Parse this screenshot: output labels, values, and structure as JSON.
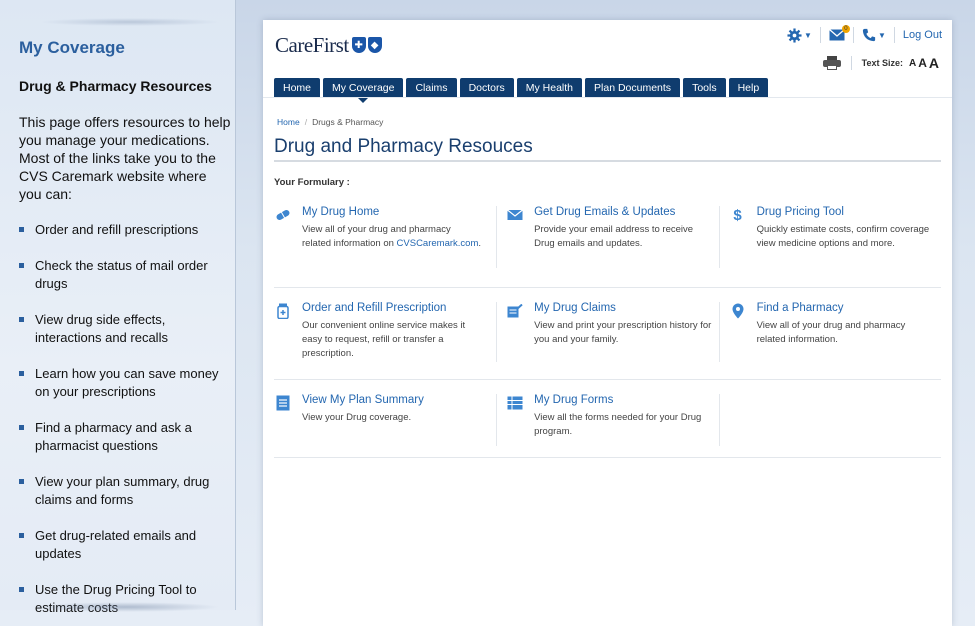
{
  "sidebar": {
    "title": "My Coverage",
    "subtitle": "Drug & Pharmacy Resources",
    "intro": "This page offers resources to help you manage your medications. Most of the links take you to the CVS Caremark website where you can:",
    "items": [
      "Order and refill prescriptions",
      "Check the status of mail order drugs",
      "View drug side effects, interactions and recalls",
      "Learn how you can save money on your prescriptions",
      "Find a pharmacy and ask a pharmacist questions",
      "View your plan summary, drug claims and forms",
      "Get drug-related emails and updates",
      "Use the Drug Pricing Tool to estimate costs"
    ]
  },
  "header": {
    "logo_text": "CareFirst",
    "logout_label": "Log Out",
    "message_badge": "0",
    "text_size_label": "Text Size:",
    "text_size_options": [
      "A",
      "A",
      "A"
    ]
  },
  "nav": {
    "tabs": [
      "Home",
      "My Coverage",
      "Claims",
      "Doctors",
      "My Health",
      "Plan Documents",
      "Tools",
      "Help"
    ],
    "active": "My Coverage"
  },
  "breadcrumb": {
    "home": "Home",
    "separator": "/",
    "current": "Drugs & Pharmacy"
  },
  "page": {
    "title": "Drug and Pharmacy Resouces",
    "formulary_label": "Your Formulary :"
  },
  "resources": [
    {
      "icon": "pill-icon",
      "title": "My Drug Home",
      "desc": "View all of your drug and pharmacy related information on ",
      "link": "CVSCaremark.com",
      "desc_end": "."
    },
    {
      "icon": "envelope-icon",
      "title": "Get Drug Emails & Updates",
      "desc": "Provide your email address to receive Drug emails and updates."
    },
    {
      "icon": "dollar-icon",
      "title": "Drug Pricing Tool",
      "desc": "Quickly estimate costs, confirm coverage view medicine options and more."
    },
    {
      "icon": "prescription-bottle-icon",
      "title": "Order and Refill Prescription",
      "desc": "Our convenient online service makes it easy to request, refill or transfer a prescription."
    },
    {
      "icon": "claims-icon",
      "title": "My Drug Claims",
      "desc": "View and print your prescription history for you and your family."
    },
    {
      "icon": "map-pin-icon",
      "title": "Find a Pharmacy",
      "desc": "View all of your drug and pharmacy related information."
    },
    {
      "icon": "document-lines-icon",
      "title": "View My Plan Summary",
      "desc": "View your Drug coverage."
    },
    {
      "icon": "forms-list-icon",
      "title": "My Drug Forms",
      "desc": "View all the forms needed for your Drug program."
    }
  ],
  "colors": {
    "nav_bg": "#0f3c6e",
    "link": "#2467b0",
    "title": "#1a3f6e",
    "accent": "#2b5f9e"
  }
}
